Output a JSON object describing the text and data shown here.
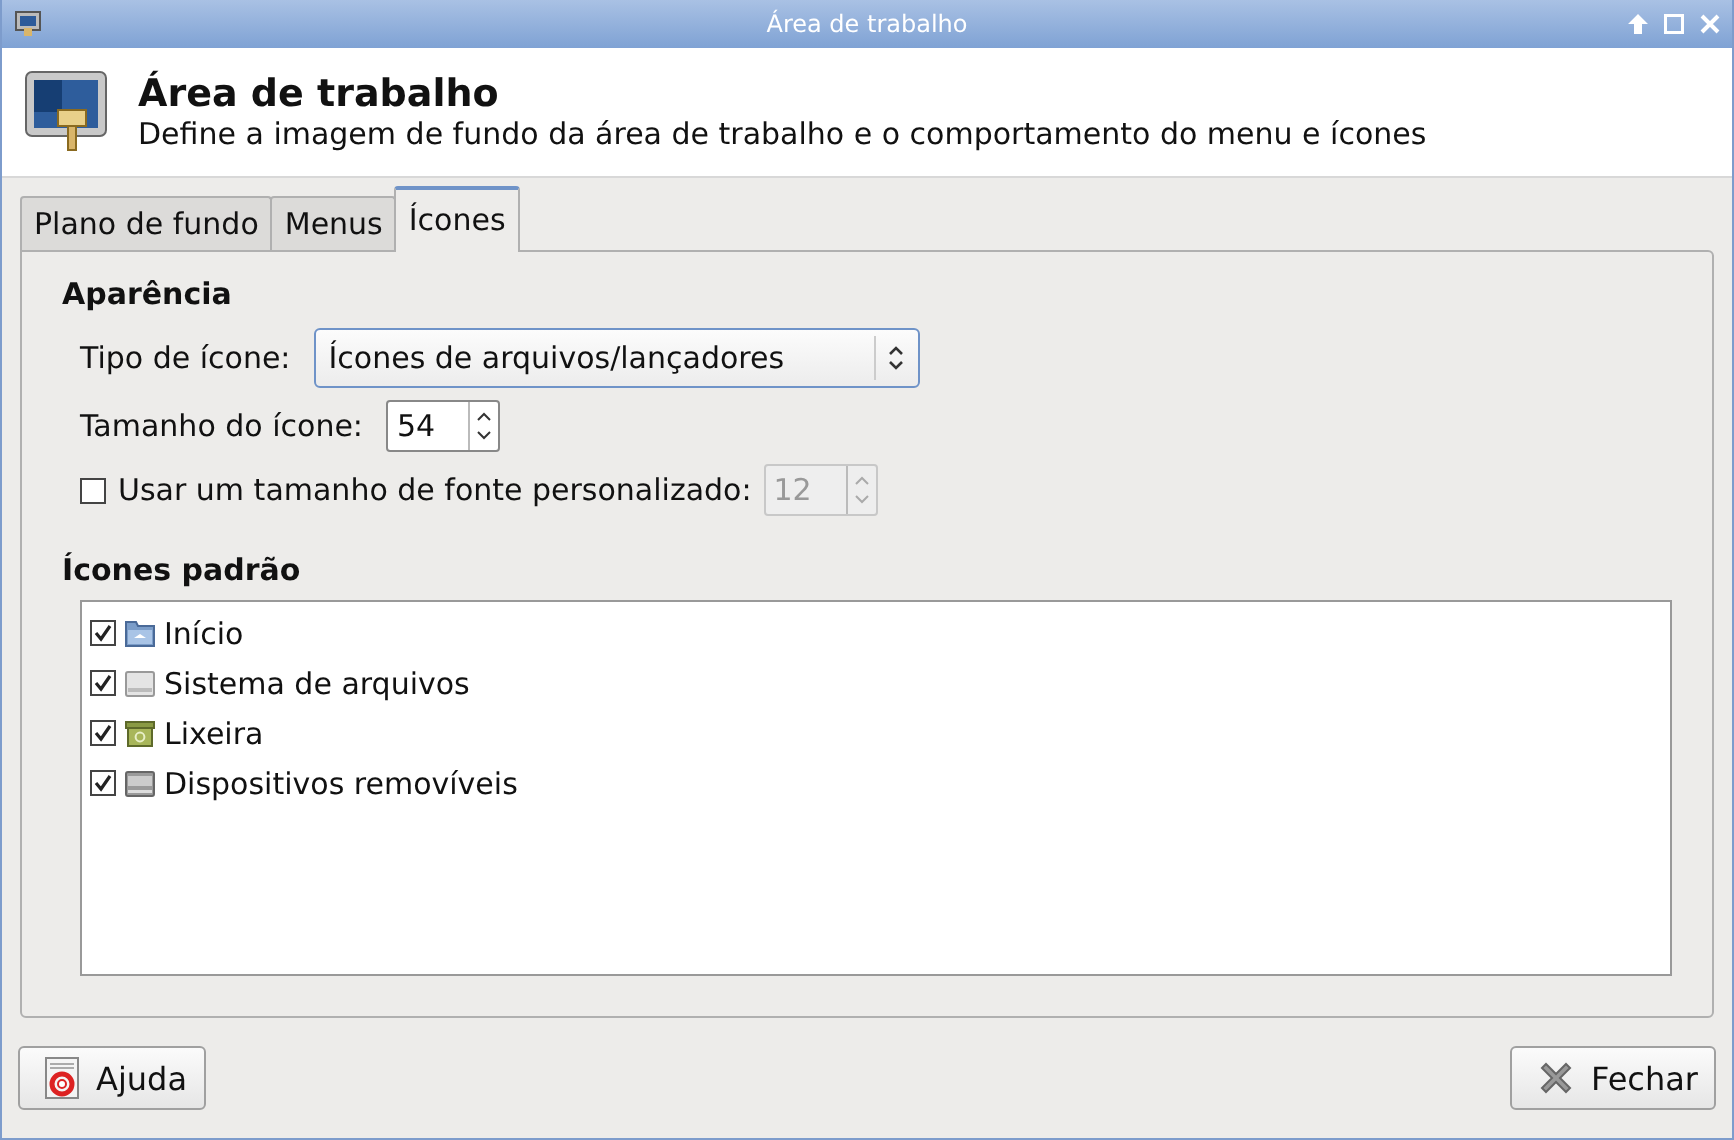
{
  "window": {
    "title": "Área de trabalho"
  },
  "header": {
    "title": "Área de trabalho",
    "subtitle": "Define a imagem de fundo da área de trabalho e o comportamento do menu e ícones"
  },
  "tabs": [
    {
      "label": "Plano de fundo",
      "selected": false
    },
    {
      "label": "Menus",
      "selected": false
    },
    {
      "label": "Ícones",
      "selected": true
    }
  ],
  "appearance": {
    "heading": "Aparência",
    "icon_type": {
      "label": "Tipo de ícone:",
      "value": "Ícones de arquivos/lançadores"
    },
    "icon_size": {
      "label": "Tamanho do ícone:",
      "value": "54",
      "disabled": false
    },
    "custom_font": {
      "label": "Usar um tamanho de fonte personalizado:",
      "checked": false,
      "value": "12",
      "disabled": true
    }
  },
  "default_icons": {
    "heading": "Ícones padrão",
    "items": [
      {
        "label": "Início",
        "checked": true,
        "kind": "folder"
      },
      {
        "label": "Sistema de arquivos",
        "checked": true,
        "kind": "drive"
      },
      {
        "label": "Lixeira",
        "checked": true,
        "kind": "trash"
      },
      {
        "label": "Dispositivos removíveis",
        "checked": true,
        "kind": "removable"
      }
    ]
  },
  "buttons": [
    {
      "label": "Ajuda",
      "kind": "help"
    },
    {
      "label": "Fechar",
      "kind": "close"
    }
  ]
}
